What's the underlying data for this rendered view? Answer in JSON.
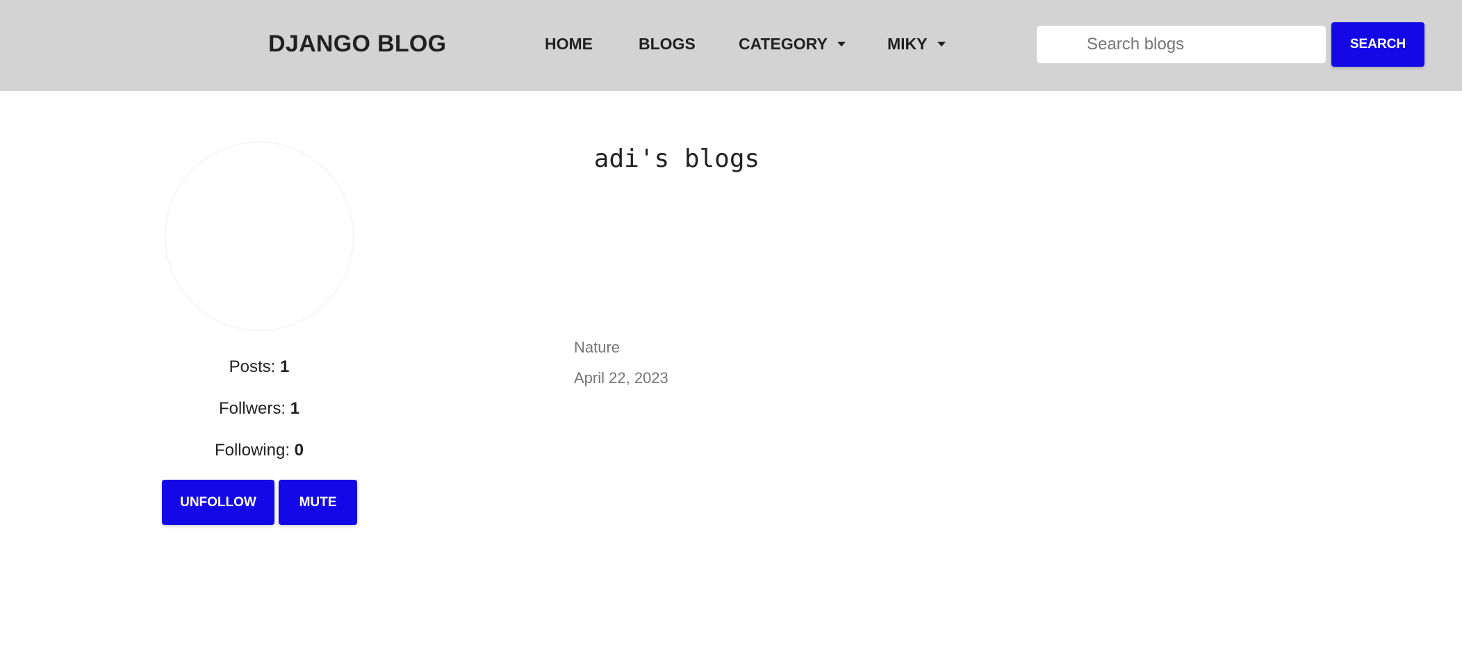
{
  "navbar": {
    "brand": "DJANGO BLOG",
    "links": {
      "home": "HOME",
      "blogs": "BLOGS",
      "category": "CATEGORY",
      "user": "MIKY"
    },
    "search": {
      "placeholder": "Search blogs",
      "value": "",
      "button_label": "SEARCH"
    }
  },
  "profile": {
    "stats": {
      "posts_label": "Posts: ",
      "posts_value": "1",
      "followers_label": "Follwers: ",
      "followers_value": "1",
      "following_label": "Following: ",
      "following_value": "0"
    },
    "actions": {
      "unfollow_label": "UNFOLLOW",
      "mute_label": "MUTE"
    }
  },
  "main": {
    "title": "adi's blogs",
    "posts": [
      {
        "category": "Nature",
        "date": "April 22, 2023"
      }
    ]
  },
  "colors": {
    "navbar_bg": "#d3d3d3",
    "accent": "#1409e6",
    "muted_text": "#757575"
  },
  "icons": {
    "category_dropdown": "chevron-down-icon",
    "user_dropdown": "chevron-down-icon"
  }
}
